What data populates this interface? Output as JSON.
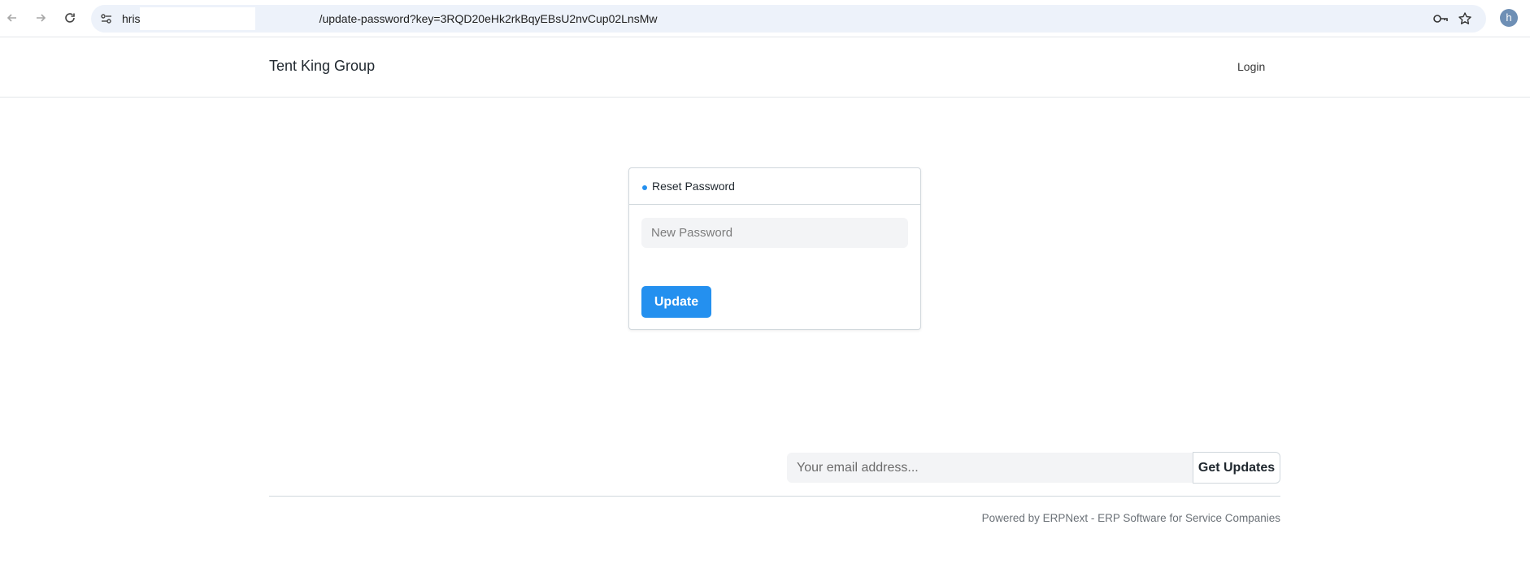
{
  "browser": {
    "url_prefix": "hris",
    "url_suffix": "/update-password?key=3RQD20eHk2rkBqyEBsU2nvCup02LnsMw",
    "profile_initial": "h",
    "icons": {
      "back": "arrow-left-icon",
      "forward": "arrow-right-icon",
      "reload": "reload-icon",
      "site_info": "tune-icon",
      "password_manager": "key-icon",
      "bookmark": "star-icon"
    }
  },
  "navbar": {
    "brand": "Tent King Group",
    "login_label": "Login"
  },
  "reset_card": {
    "title": "Reset Password",
    "password_placeholder": "New Password",
    "update_label": "Update",
    "accent_color": "#2490ef"
  },
  "footer": {
    "email_placeholder": "Your email address...",
    "subscribe_label": "Get Updates",
    "powered_by": "Powered by ERPNext - ERP Software for Service Companies"
  }
}
